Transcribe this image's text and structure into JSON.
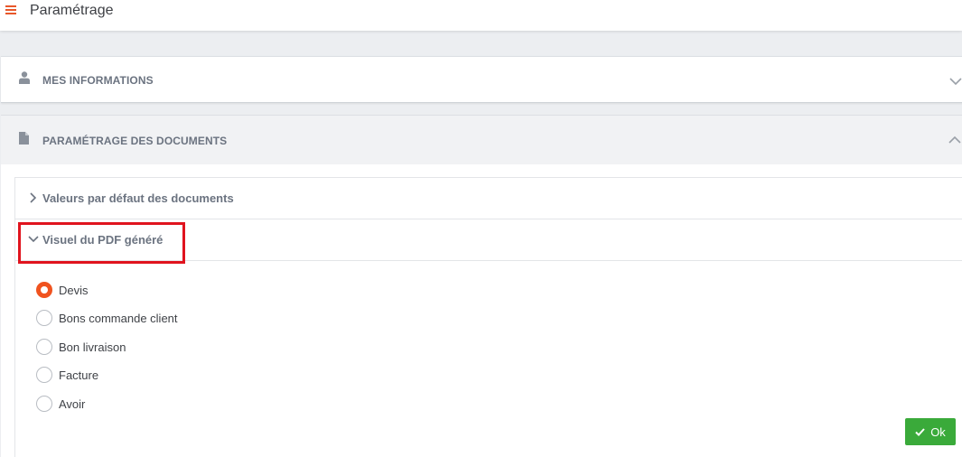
{
  "header": {
    "title": "Paramétrage",
    "menu_icon": "hamburger-menu-icon",
    "accent_color": "#e8572a"
  },
  "panels": {
    "info": {
      "label": "MES INFORMATIONS",
      "icon": "user-icon",
      "state": "collapsed"
    },
    "documents": {
      "label": "PARAMÉTRAGE DES DOCUMENTS",
      "icon": "document-icon",
      "state": "expanded"
    }
  },
  "subpanels": [
    {
      "label": "Valeurs par défaut des documents",
      "state": "collapsed"
    },
    {
      "label": "Visuel du PDF généré",
      "state": "expanded",
      "highlighted": true
    }
  ],
  "radios": {
    "selected": "Devis",
    "options": [
      "Devis",
      "Bons commande client",
      "Bon livraison",
      "Facture",
      "Avoir"
    ],
    "selected_color": "#f0531f"
  },
  "actions": {
    "ok_label": "Ok",
    "ok_color": "#3aaa3a"
  }
}
